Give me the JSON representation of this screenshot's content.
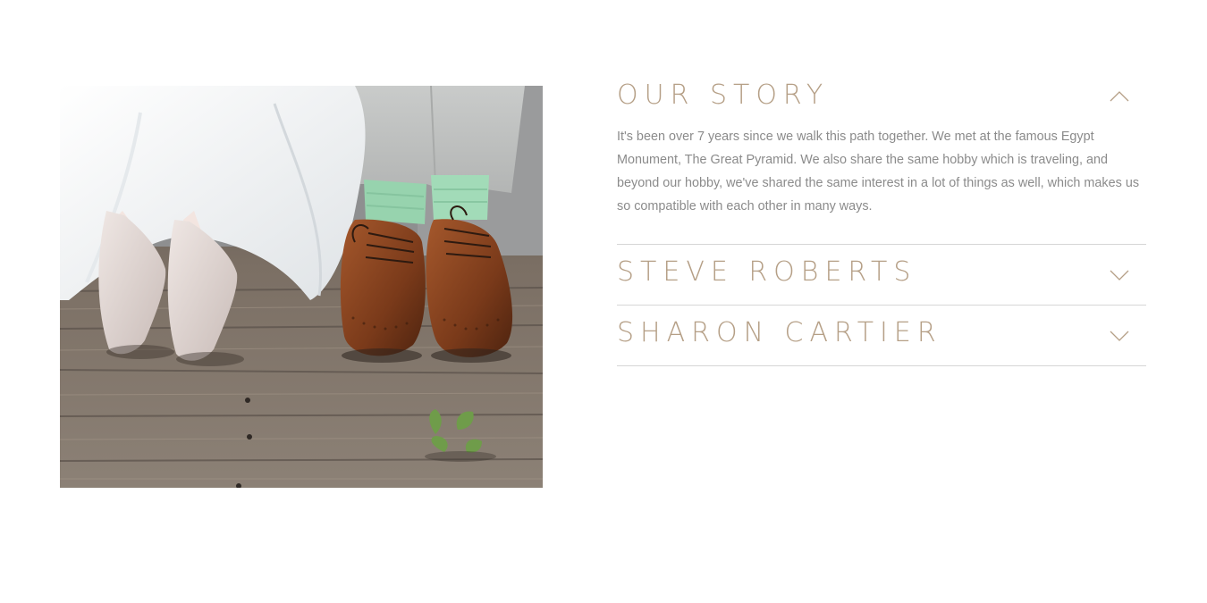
{
  "photo": {
    "alt": "Bride's glittery heels and groom's brown brogues with green socks on a wooden deck",
    "icon": "wedding-photo"
  },
  "accordion": {
    "items": [
      {
        "title": "OUR STORY",
        "state": "expanded",
        "toggle_icon": "chevron-up-icon",
        "body": "It's been over 7 years since we walk this path together. We met at the famous Egypt Monument, The Great Pyramid. We also share the same hobby which is traveling, and beyond our hobby, we've shared the same interest in a lot of things as well, which makes us so compatible with each other in many ways."
      },
      {
        "title": "STEVE ROBERTS",
        "state": "collapsed",
        "toggle_icon": "chevron-down-icon"
      },
      {
        "title": "SHARON CARTIER",
        "state": "collapsed",
        "toggle_icon": "chevron-down-icon"
      }
    ]
  },
  "colors": {
    "heading": "#b59f86",
    "body_text": "#8b8b8b",
    "divider": "#d6d6d6",
    "background": "#ffffff"
  }
}
